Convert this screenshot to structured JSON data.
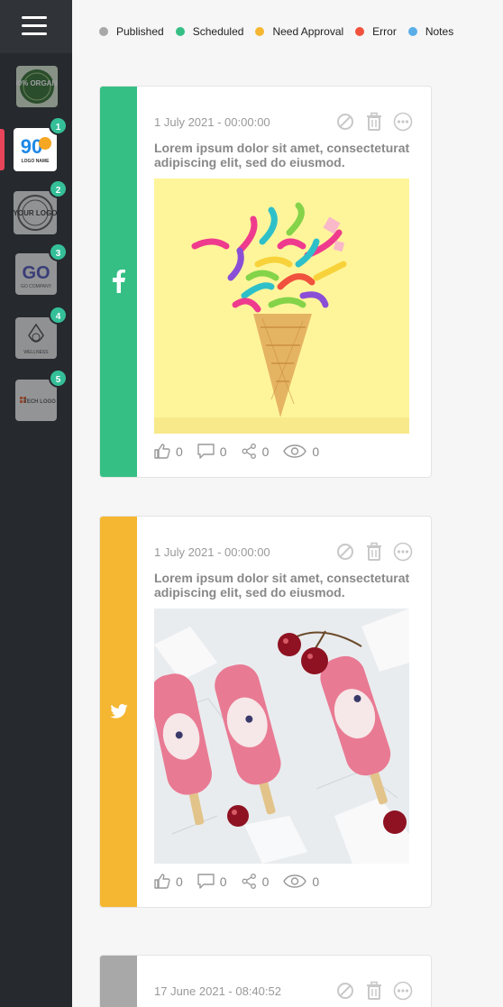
{
  "legend": [
    {
      "label": "Published",
      "color": "#a8a8a8"
    },
    {
      "label": "Scheduled",
      "color": "#35bf84"
    },
    {
      "label": "Need Approval",
      "color": "#f5b731"
    },
    {
      "label": "Error",
      "color": "#f0523e"
    },
    {
      "label": "Notes",
      "color": "#5aaee8"
    }
  ],
  "accounts": [
    {
      "name": "organic-logo",
      "badge": null,
      "logo_text": "100% ORGANIC"
    },
    {
      "name": "90-logo",
      "badge": "1",
      "logo_text": "90",
      "logo_caption": "LOGO NAME"
    },
    {
      "name": "your-logo",
      "badge": "2",
      "logo_text": "YOUR LOGO"
    },
    {
      "name": "go-company",
      "badge": "3",
      "logo_text": "GO",
      "logo_caption": "GO COMPANY"
    },
    {
      "name": "wellness",
      "badge": "4",
      "logo_text": "WELLNESS"
    },
    {
      "name": "tech-logo",
      "badge": "5",
      "logo_text": "TECH LOGO"
    }
  ],
  "posts": [
    {
      "status_color": "#35bf84",
      "network": "facebook",
      "date": "1 July 2021 - 00:00:00",
      "text": "Lorem ipsum dolor sit amet, consecteturat adipiscing elit, sed do eiusmod.",
      "image": "ice-cream-cone-confetti",
      "likes": "0",
      "comments": "0",
      "shares": "0",
      "views": "0"
    },
    {
      "status_color": "#f5b731",
      "network": "twitter",
      "date": "1 July 2021 - 00:00:00",
      "text": "Lorem ipsum dolor sit amet, consecteturat adipiscing elit, sed do eiusmod.",
      "image": "popsicles-cherries",
      "likes": "0",
      "comments": "0",
      "shares": "0",
      "views": "0"
    },
    {
      "status_color": "#a8a8a8",
      "network": "",
      "date": "17 June 2021 - 08:40:52"
    }
  ]
}
